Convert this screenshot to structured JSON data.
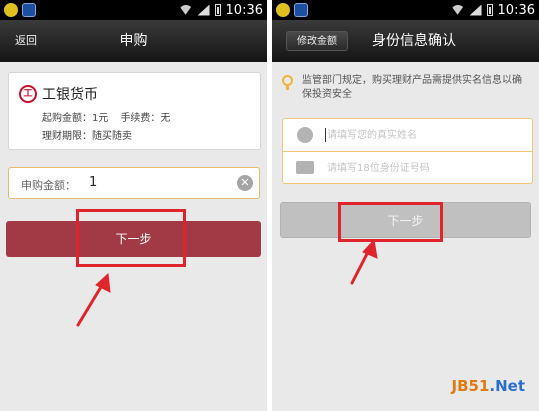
{
  "left": {
    "status_time": "10:36",
    "back": "返回",
    "title": "申购",
    "product": {
      "logo_text": "工",
      "name": "工银货币",
      "min_purchase": "起购金额：1元",
      "fee": "手续费：无",
      "term": "理财期限：随买随卖"
    },
    "amount": {
      "label": "申购金额：",
      "value": "1"
    },
    "next": "下一步"
  },
  "right": {
    "status_time": "10:36",
    "modify": "修改金额",
    "title": "身份信息确认",
    "notice": "监管部门规定，购买理财产品需提供实名信息以确保投资安全",
    "name_placeholder": "请填写您的真实姓名",
    "id_placeholder": "请填写18位身份证号码",
    "next": "下一步"
  },
  "watermark": {
    "brand": "JB51",
    "tld": ".Net"
  },
  "colors": {
    "next_button": "#a23a45",
    "highlight": "#e0242b",
    "input_border": "#e7b96a"
  },
  "icons": [
    "wifi-icon",
    "signal-icon",
    "battery-icon",
    "clear-icon",
    "bulb-icon",
    "user-icon",
    "id-card-icon",
    "arrow-icon"
  ]
}
